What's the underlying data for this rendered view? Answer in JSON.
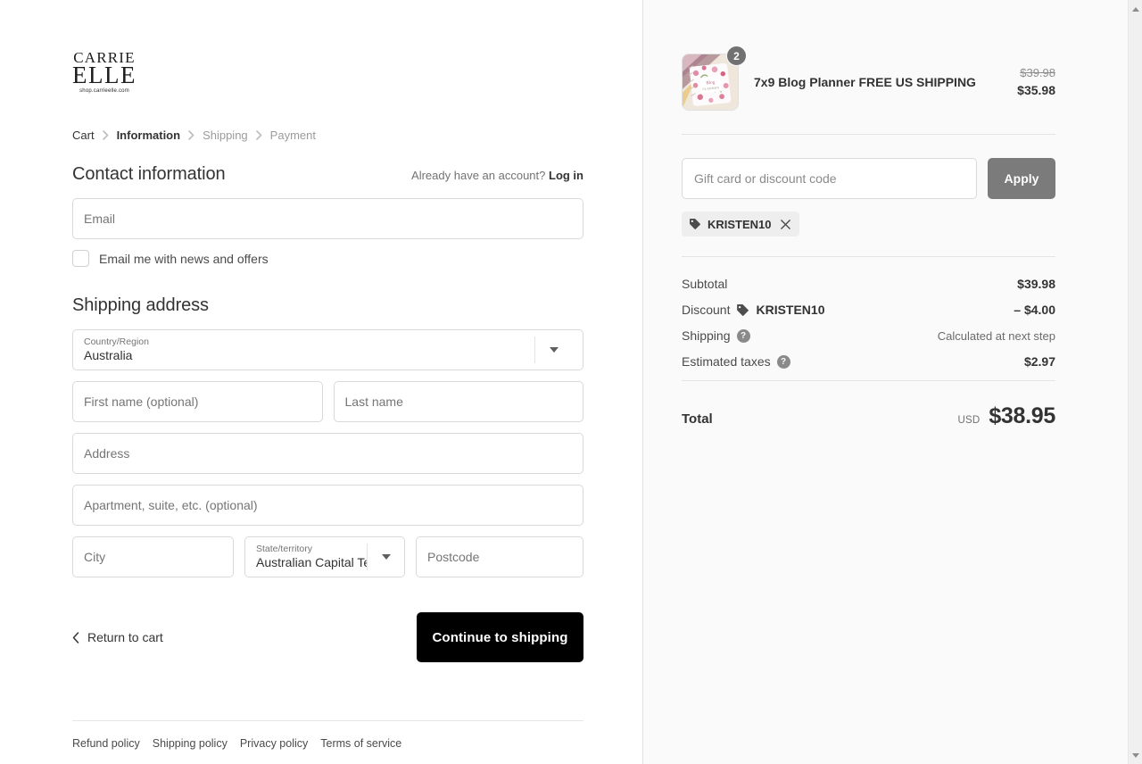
{
  "brand": {
    "logo_line1": "CARRIE",
    "logo_line2": "ELLE",
    "logo_tagline": "shop.carrieelle.com"
  },
  "breadcrumb": {
    "items": [
      {
        "label": "Cart",
        "state": "link"
      },
      {
        "label": "Information",
        "state": "current"
      },
      {
        "label": "Shipping",
        "state": "inactive"
      },
      {
        "label": "Payment",
        "state": "inactive"
      }
    ]
  },
  "contact": {
    "title": "Contact information",
    "account_note": "Already have an account?",
    "login_label": "Log in",
    "email_placeholder": "Email",
    "email_value": "",
    "newsletter_label": "Email me with news and offers",
    "newsletter_checked": false
  },
  "shipping_address": {
    "title": "Shipping address",
    "country": {
      "label": "Country/Region",
      "value": "Australia"
    },
    "first_name": {
      "placeholder": "First name (optional)",
      "value": ""
    },
    "last_name": {
      "placeholder": "Last name",
      "value": ""
    },
    "address": {
      "placeholder": "Address",
      "value": ""
    },
    "apartment": {
      "placeholder": "Apartment, suite, etc. (optional)",
      "value": ""
    },
    "city": {
      "placeholder": "City",
      "value": ""
    },
    "state": {
      "label": "State/territory",
      "value": "Australian Capital Territory"
    },
    "postcode": {
      "placeholder": "Postcode",
      "value": ""
    }
  },
  "actions": {
    "return_label": "Return to cart",
    "continue_label": "Continue to shipping"
  },
  "footer": {
    "links": [
      "Refund policy",
      "Shipping policy",
      "Privacy policy",
      "Terms of service"
    ]
  },
  "order_summary": {
    "line_items": [
      {
        "title": "7x9 Blog Planner FREE US SHIPPING",
        "quantity": "2",
        "price_original": "$39.98",
        "price_discounted": "$35.98"
      }
    ],
    "discount_field": {
      "placeholder": "Gift card or discount code",
      "value": "",
      "apply_label": "Apply"
    },
    "applied_codes": [
      "KRISTEN10"
    ],
    "totals": [
      {
        "label": "Subtotal",
        "value": "$39.98",
        "muted": false
      },
      {
        "label": "Discount",
        "code": "KRISTEN10",
        "value": "– $4.00",
        "muted": false
      },
      {
        "label": "Shipping",
        "help": true,
        "value": "Calculated at next step",
        "muted": true
      },
      {
        "label": "Estimated taxes",
        "help": true,
        "value": "$2.97",
        "muted": false
      }
    ],
    "grand_total": {
      "label": "Total",
      "currency": "USD",
      "amount": "$38.95"
    }
  },
  "colors": {
    "accent_button": "#000000",
    "apply_button": "#7b7b7b",
    "summary_bg": "#fafafa",
    "badge": "#717171"
  }
}
